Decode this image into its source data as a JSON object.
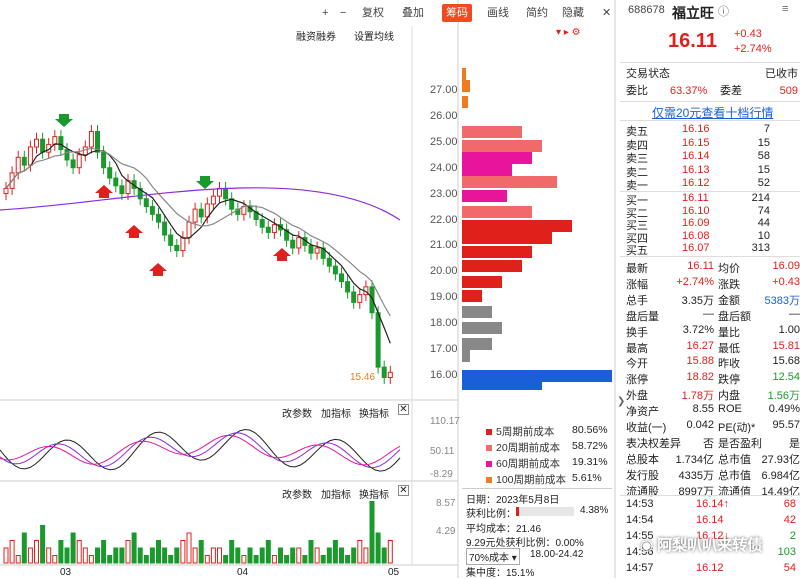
{
  "toolbar": {
    "plus": "+",
    "minus": "−",
    "fuquan": "复权",
    "diejia": "叠加",
    "chouma": "筹码",
    "huaxian": "画线",
    "jianyue": "简约",
    "yincang": "隐藏"
  },
  "subtoolbar": {
    "rongzi": "融资融券",
    "shezhi": "设置均线"
  },
  "yaxis": [
    "27.00",
    "26.00",
    "25.00",
    "24.00",
    "23.00",
    "22.00",
    "21.00",
    "20.00",
    "19.00",
    "18.00",
    "17.00",
    "16.00"
  ],
  "price_marker": "15.46",
  "indicator1": {
    "gaicanshu": "改参数",
    "jiazhibiao": "加指标",
    "huanzhibiao": "换指标",
    "y_top": "110.17",
    "y_mid": "50.11",
    "y_bot": "-8.29"
  },
  "indicator2": {
    "gaicanshu": "改参数",
    "jiazhibiao": "加指标",
    "huanzhibiao": "换指标",
    "y_top": "8.57",
    "y_mid": "4.29"
  },
  "xaxis": [
    "03",
    "04",
    "05"
  ],
  "cost_legend": [
    {
      "label": "5周期前成本",
      "value": "80.56%",
      "color": "#e0201b"
    },
    {
      "label": "20周期前成本",
      "value": "58.72%",
      "color": "#f06a6a"
    },
    {
      "label": "60周期前成本",
      "value": "19.31%",
      "color": "#e8149a"
    },
    {
      "label": "100周期前成本",
      "value": "5.61%",
      "color": "#f07a20"
    }
  ],
  "chip": {
    "date": "日期：2023年5月8日",
    "profit_label": "获利比例：",
    "profit_value": "4.38%",
    "profit_fill": 0.0438,
    "avg_cost": "平均成本：21.46",
    "r929": "9.29元处获利比例：0.00%",
    "cost70_select": "70%成本",
    "cost70_range": "18.00-24.42",
    "concentration": "集中度：15.1%"
  },
  "stock": {
    "code": "688678",
    "name": "福立旺",
    "price": "16.11",
    "change": "+0.43",
    "pct": "+2.74%"
  },
  "status": {
    "label": "交易状态",
    "value": "已收市"
  },
  "weibi": {
    "l1": "委比",
    "v1": "63.37%",
    "l2": "委差",
    "v2": "509"
  },
  "promo": "仅需20元查看十档行情",
  "asks": [
    {
      "label": "卖五",
      "price": "16.16",
      "vol": "7"
    },
    {
      "label": "卖四",
      "price": "16.15",
      "vol": "15"
    },
    {
      "label": "卖三",
      "price": "16.14",
      "vol": "58"
    },
    {
      "label": "卖二",
      "price": "16.13",
      "vol": "15"
    },
    {
      "label": "卖一",
      "price": "16.12",
      "vol": "52"
    }
  ],
  "bids": [
    {
      "label": "买一",
      "price": "16.11",
      "vol": "214"
    },
    {
      "label": "买二",
      "price": "16.10",
      "vol": "74"
    },
    {
      "label": "买三",
      "price": "16.09",
      "vol": "44"
    },
    {
      "label": "买四",
      "price": "16.08",
      "vol": "10"
    },
    {
      "label": "买五",
      "price": "16.07",
      "vol": "313"
    }
  ],
  "stats": [
    {
      "l1": "最新",
      "v1": "16.11",
      "c1": "red",
      "l2": "均价",
      "v2": "16.09",
      "c2": "red"
    },
    {
      "l1": "涨幅",
      "v1": "+2.74%",
      "c1": "red",
      "l2": "涨跌",
      "v2": "+0.43",
      "c2": "red"
    },
    {
      "l1": "总手",
      "v1": "3.35万",
      "c1": "",
      "l2": "金额",
      "v2": "5383万",
      "c2": "blue"
    },
    {
      "l1": "盘后量",
      "v1": "—",
      "c1": "",
      "l2": "盘后额",
      "v2": "—",
      "c2": ""
    },
    {
      "l1": "换手",
      "v1": "3.72%",
      "c1": "",
      "l2": "量比",
      "v2": "1.00",
      "c2": ""
    },
    {
      "l1": "最高",
      "v1": "16.27",
      "c1": "red",
      "l2": "最低",
      "v2": "15.81",
      "c2": "red"
    },
    {
      "l1": "今开",
      "v1": "15.88",
      "c1": "red",
      "l2": "昨收",
      "v2": "15.68",
      "c2": ""
    },
    {
      "l1": "涨停",
      "v1": "18.82",
      "c1": "red",
      "l2": "跌停",
      "v2": "12.54",
      "c2": "green"
    },
    {
      "l1": "外盘",
      "v1": "1.78万",
      "c1": "red",
      "l2": "内盘",
      "v2": "1.56万",
      "c2": "green"
    },
    {
      "l1": "净资产",
      "v1": "8.55",
      "c1": "",
      "l2": "ROE",
      "v2": "0.49%",
      "c2": ""
    },
    {
      "l1": "收益(一)",
      "v1": "0.042",
      "c1": "",
      "l2": "PE(动)*",
      "v2": "95.57",
      "c2": ""
    },
    {
      "l1": "表决权差异",
      "v1": "否",
      "c1": "",
      "l2": "是否盈利",
      "v2": "是",
      "c2": ""
    },
    {
      "l1": "总股本",
      "v1": "1.734亿",
      "c1": "",
      "l2": "总市值",
      "v2": "27.93亿",
      "c2": ""
    },
    {
      "l1": "发行股",
      "v1": "4335万",
      "c1": "",
      "l2": "总市值",
      "v2": "6.984亿",
      "c2": ""
    },
    {
      "l1": "流通股",
      "v1": "8997万",
      "c1": "",
      "l2": "流通值",
      "v2": "14.49亿",
      "c2": ""
    }
  ],
  "ticks": [
    {
      "time": "14:53",
      "price": "16.14↑",
      "vol": "68"
    },
    {
      "time": "14:54",
      "price": "16.14",
      "vol": "42"
    },
    {
      "time": "14:55",
      "price": "16.12↓",
      "vol": "2"
    },
    {
      "time": "14:56",
      "price": "",
      "vol": "103"
    },
    {
      "time": "14:57",
      "price": "16.12",
      "vol": "54"
    }
  ],
  "watermark": "阿梨叭叭来转债"
}
